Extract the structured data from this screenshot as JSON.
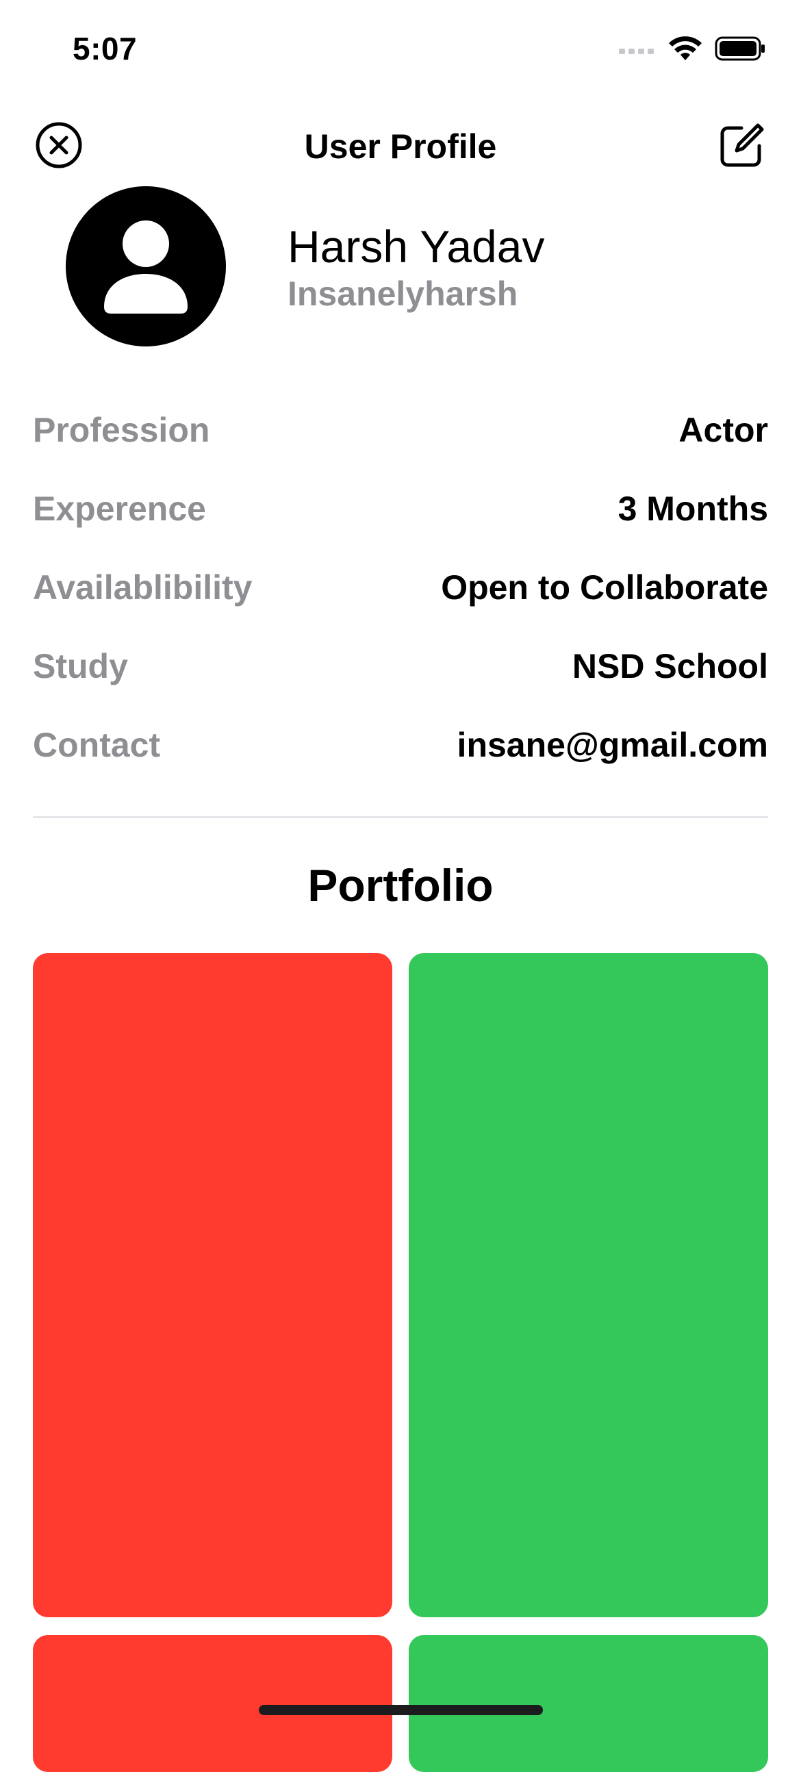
{
  "status_bar": {
    "time": "5:07"
  },
  "nav": {
    "title": "User Profile",
    "close_icon": "xmark-circle-icon",
    "edit_icon": "square-and-pencil-icon"
  },
  "profile": {
    "avatar_icon": "person-circle-icon",
    "name": "Harsh Yadav",
    "handle": "Insanelyharsh"
  },
  "details": [
    {
      "label": "Profession",
      "value": "Actor"
    },
    {
      "label": "Experence",
      "value": "3 Months"
    },
    {
      "label": "Availablibility",
      "value": "Open to Collaborate"
    },
    {
      "label": "Study",
      "value": "NSD School"
    },
    {
      "label": "Contact",
      "value": "insane@gmail.com"
    }
  ],
  "portfolio": {
    "title": "Portfolio",
    "items": [
      {
        "color": "#ff3b30"
      },
      {
        "color": "#34c759"
      },
      {
        "color": "#ff3b30"
      },
      {
        "color": "#34c759"
      }
    ]
  }
}
